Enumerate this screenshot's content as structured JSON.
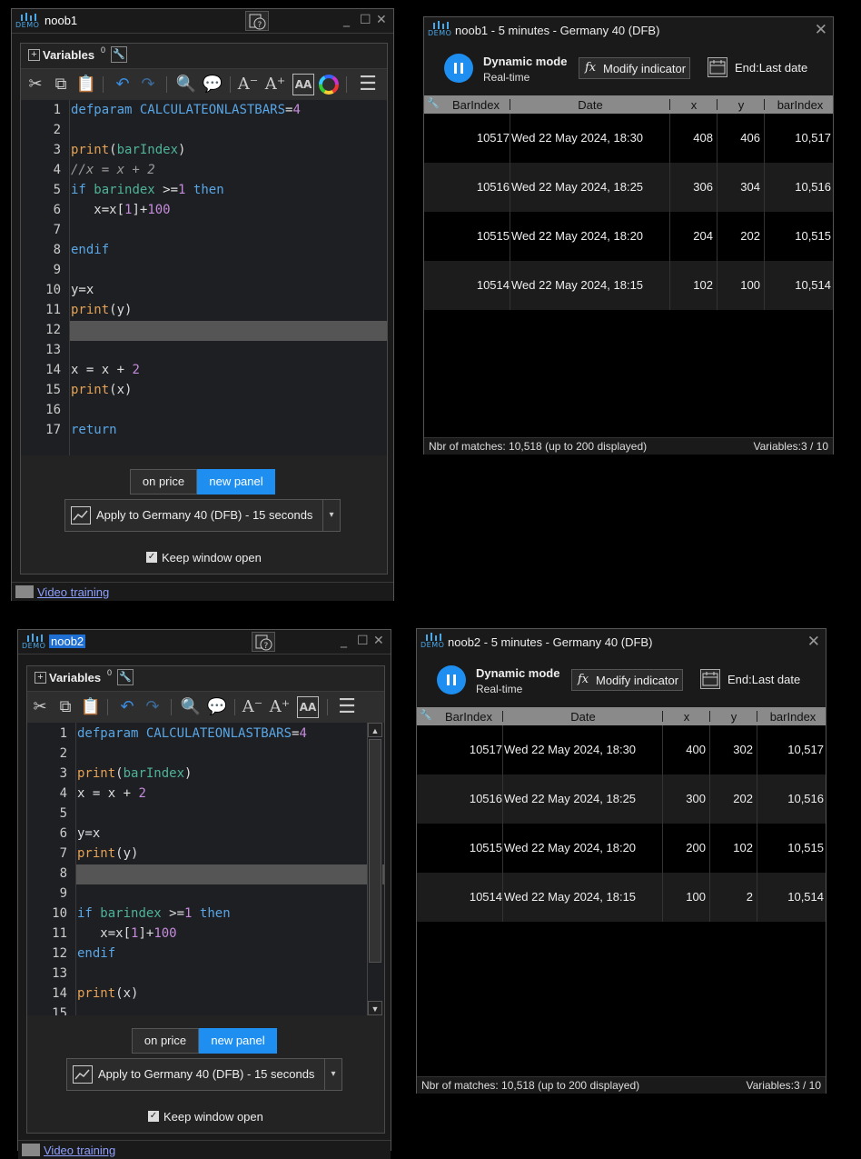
{
  "editor1": {
    "title": "noob1",
    "variables_label": "Variables",
    "variables_count": "0",
    "lines": [
      {
        "n": "1",
        "html": "<span class='kw'>defparam</span> <span class='kw'>CALCULATEONLASTBARS</span>=<span class='num'>4</span>"
      },
      {
        "n": "2",
        "html": ""
      },
      {
        "n": "3",
        "html": "<span class='fn'>print</span>(<span class='kw2'>barIndex</span>)"
      },
      {
        "n": "4",
        "html": "<span class='cm'>//x = x + 2</span>"
      },
      {
        "n": "5",
        "html": "<span class='kw'>if</span> <span class='kw2'>barindex</span> &gt;=<span class='num'>1</span> <span class='kw'>then</span>"
      },
      {
        "n": "6",
        "html": "   x=x[<span class='num'>1</span>]+<span class='num'>100</span>"
      },
      {
        "n": "7",
        "html": ""
      },
      {
        "n": "8",
        "html": "<span class='kw'>endif</span>"
      },
      {
        "n": "9",
        "html": ""
      },
      {
        "n": "10",
        "html": "y=x"
      },
      {
        "n": "11",
        "html": "<span class='fn'>print</span>(y)"
      },
      {
        "n": "12",
        "html": ""
      },
      {
        "n": "13",
        "html": ""
      },
      {
        "n": "14",
        "html": "x = x + <span class='num'>2</span>"
      },
      {
        "n": "15",
        "html": "<span class='fn'>print</span>(x)"
      },
      {
        "n": "16",
        "html": ""
      },
      {
        "n": "17",
        "html": "<span class='kw'>return</span>"
      }
    ],
    "highlight_line": "12",
    "btn_on_price": "on price",
    "btn_new_panel": "new panel",
    "apply_label": "Apply to Germany 40 (DFB) - 15 seconds",
    "keep_open": "Keep window open",
    "video_training": "Video training"
  },
  "editor2": {
    "title": "noob2",
    "variables_label": "Variables",
    "variables_count": "0",
    "lines": [
      {
        "n": "1",
        "html": "<span class='kw'>defparam</span> <span class='kw'>CALCULATEONLASTBARS</span>=<span class='num'>4</span>"
      },
      {
        "n": "2",
        "html": ""
      },
      {
        "n": "3",
        "html": "<span class='fn'>print</span>(<span class='kw2'>barIndex</span>)"
      },
      {
        "n": "4",
        "html": "x = x + <span class='num'>2</span>"
      },
      {
        "n": "5",
        "html": ""
      },
      {
        "n": "6",
        "html": "y=x"
      },
      {
        "n": "7",
        "html": "<span class='fn'>print</span>(y)"
      },
      {
        "n": "8",
        "html": ""
      },
      {
        "n": "9",
        "html": ""
      },
      {
        "n": "10",
        "html": "<span class='kw'>if</span> <span class='kw2'>barindex</span> &gt;=<span class='num'>1</span> <span class='kw'>then</span>"
      },
      {
        "n": "11",
        "html": "   x=x[<span class='num'>1</span>]+<span class='num'>100</span>"
      },
      {
        "n": "12",
        "html": "<span class='kw'>endif</span>"
      },
      {
        "n": "13",
        "html": ""
      },
      {
        "n": "14",
        "html": "<span class='fn'>print</span>(x)"
      },
      {
        "n": "15",
        "html": ""
      }
    ],
    "highlight_line": "8",
    "btn_on_price": "on price",
    "btn_new_panel": "new panel",
    "apply_label": "Apply to Germany 40 (DFB) - 15 seconds",
    "keep_open": "Keep window open",
    "video_training": "Video training"
  },
  "vars1": {
    "title": "noob1 - 5 minutes - Germany 40 (DFB)",
    "mode_title": "Dynamic mode",
    "mode_sub": "Real-time",
    "modify": "Modify indicator",
    "end_label": "End:Last date",
    "headers": [
      "BarIndex",
      "Date",
      "x",
      "y",
      "barIndex"
    ],
    "rows": [
      [
        "10517",
        "Wed 22 May 2024, 18:30",
        "408",
        "406",
        "10,517"
      ],
      [
        "10516",
        "Wed 22 May 2024, 18:25",
        "306",
        "304",
        "10,516"
      ],
      [
        "10515",
        "Wed 22 May 2024, 18:20",
        "204",
        "202",
        "10,515"
      ],
      [
        "10514",
        "Wed 22 May 2024, 18:15",
        "102",
        "100",
        "10,514"
      ]
    ],
    "status_left": "Nbr of matches: 10,518 (up to 200 displayed)",
    "status_right": "Variables:3 / 10"
  },
  "vars2": {
    "title": "noob2 - 5 minutes - Germany 40 (DFB)",
    "mode_title": "Dynamic mode",
    "mode_sub": "Real-time",
    "modify": "Modify indicator",
    "end_label": "End:Last date",
    "headers": [
      "BarIndex",
      "Date",
      "x",
      "y",
      "barIndex"
    ],
    "rows": [
      [
        "10517",
        "Wed 22 May 2024, 18:30",
        "400",
        "302",
        "10,517"
      ],
      [
        "10516",
        "Wed 22 May 2024, 18:25",
        "300",
        "202",
        "10,516"
      ],
      [
        "10515",
        "Wed 22 May 2024, 18:20",
        "200",
        "102",
        "10,515"
      ],
      [
        "10514",
        "Wed 22 May 2024, 18:15",
        "100",
        "2",
        "10,514"
      ]
    ],
    "status_left": "Nbr of matches: 10,518 (up to 200 displayed)",
    "status_right": "Variables:3 / 10"
  },
  "demo_text": "DEMO"
}
